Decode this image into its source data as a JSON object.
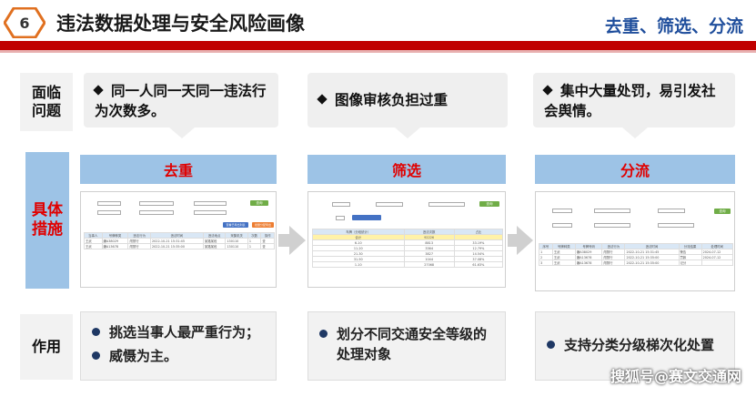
{
  "header": {
    "badge_number": "6",
    "title": "违法数据处理与安全风险画像",
    "subtitle": "去重、筛选、分流"
  },
  "rows": {
    "problem_label": "面临\n问题",
    "method_label": "具体\n措施",
    "effect_label": "作用"
  },
  "problems": [
    {
      "text": "同一人同一天同一违法行为次数多。"
    },
    {
      "text": "图像审核负担过重"
    },
    {
      "text": "集中大量处罚，易引发社会舆情。"
    }
  ],
  "methods": [
    {
      "title": "去重"
    },
    {
      "title": "筛选"
    },
    {
      "title": "分流"
    }
  ],
  "effects": [
    {
      "lines": [
        "挑选当事人最严重行为；",
        "威慑为主。"
      ]
    },
    {
      "lines": [
        "划分不同交通安全等级的处理对象"
      ]
    },
    {
      "lines": [
        "支持分类分级梯次化处置"
      ]
    }
  ],
  "shot1": {
    "search_btn": "查询",
    "btn_a": "查看已导出列表",
    "btn_b": "批量分配导出",
    "headers": [
      "当事人",
      "号牌种类",
      "违法行为",
      "违法时间",
      "违法地点",
      "采集机关",
      "次数",
      "操作"
    ],
    "rows": [
      [
        "王武",
        "嫌A38029",
        "闯禁行",
        "2022-10-21 15:31:45",
        "某路某段",
        "130110",
        "1",
        "查"
      ],
      [
        "王武",
        "嫌A13678",
        "闯禁行",
        "2022-10-21 15:35:00",
        "某路某段",
        "130110",
        "1",
        "查"
      ]
    ]
  },
  "shot2": {
    "search_btn": "查询",
    "headers": [
      "车牌（分段统计）",
      "违法次数",
      "占比"
    ],
    "rows": [
      [
        "合计",
        "92226",
        ""
      ],
      [
        "6-10",
        "8813",
        "33.19%"
      ],
      [
        "11-20",
        "3364",
        "12.79%"
      ],
      [
        "21-30",
        "3827",
        "14.54%"
      ],
      [
        "31-50",
        "1044",
        "37.08%"
      ],
      [
        "1-10",
        "27068",
        "61.63%"
      ]
    ]
  },
  "shot3": {
    "search_btn": "查询",
    "headers": [
      "序号",
      "号牌种类",
      "号牌号码",
      "违法行为",
      "违法时间",
      "分流结果",
      "处理时间"
    ],
    "rows": [
      [
        "1",
        "王武",
        "嫌A38029",
        "闯禁行",
        "2022-10-21 15:31:45",
        "警告",
        "2024-07-12"
      ],
      [
        "2",
        "王武",
        "嫌A13678",
        "闯禁行",
        "2022-10-21 15:35:00",
        "罚款",
        "2024-07-12"
      ],
      [
        "3",
        "王武",
        "嫌A13678",
        "闯禁行",
        "2022-10-21 15:35:00",
        "记分",
        ""
      ]
    ]
  },
  "watermark": "搜狐号@赛文交通网",
  "colors": {
    "accent_red": "#c00000",
    "panel_blue": "#9dc3e6",
    "title_blue": "#1f4e9c"
  }
}
